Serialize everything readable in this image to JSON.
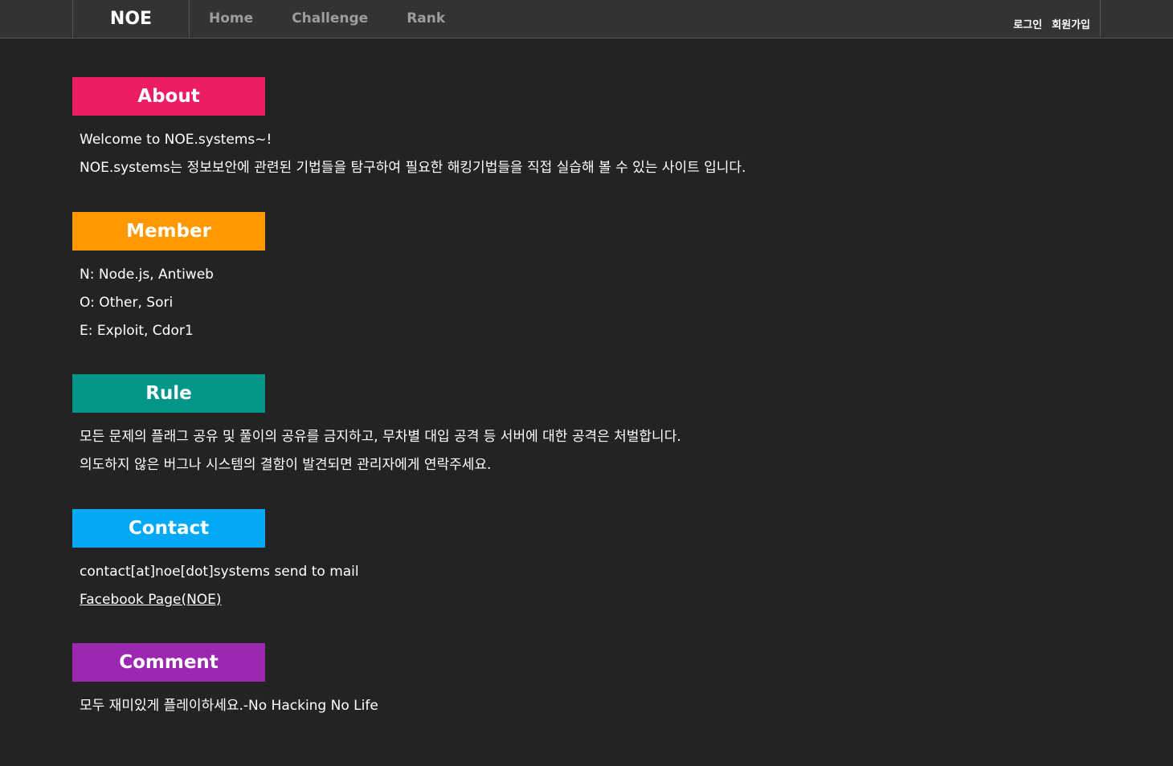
{
  "nav": {
    "brand": "NOE",
    "links": [
      "Home",
      "Challenge",
      "Rank"
    ],
    "login": "로그인",
    "signup": "회원가입"
  },
  "colors": {
    "background": "#232323",
    "navbar": "#333333",
    "about": "#ec1e63",
    "member": "#fe9800",
    "rule": "#019688",
    "contact": "#03a9f4",
    "comment": "#9c27b0"
  },
  "sections": {
    "about": {
      "title": "About",
      "lines": [
        "Welcome to NOE.systems~!",
        "NOE.systems는 정보보안에 관련된 기법들을 탐구하여 필요한 해킹기법들을 직접 실습해 볼 수 있는 사이트 입니다."
      ]
    },
    "member": {
      "title": "Member",
      "lines": [
        "N: Node.js, Antiweb",
        "O: Other, Sori",
        "E: Exploit, Cdor1"
      ]
    },
    "rule": {
      "title": "Rule",
      "lines": [
        "모든 문제의 플래그 공유 및 풀이의 공유를 금지하고, 무차별 대입 공격 등 서버에 대한 공격은 처벌합니다.",
        "의도하지 않은 버그나 시스템의 결함이 발견되면 관리자에게 연락주세요."
      ]
    },
    "contact": {
      "title": "Contact",
      "mail": "contact[at]noe[dot]systems send to mail",
      "facebook": "Facebook Page(NOE)"
    },
    "comment": {
      "title": "Comment",
      "lines": [
        "모두 재미있게 플레이하세요.-No Hacking No Life"
      ]
    }
  }
}
